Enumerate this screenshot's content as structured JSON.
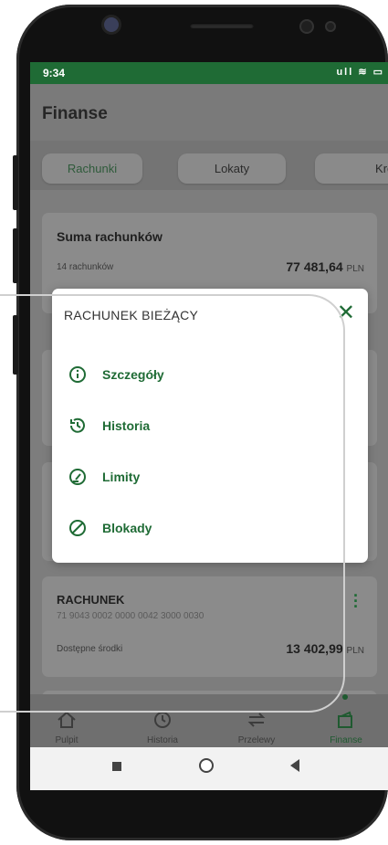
{
  "status_bar": {
    "time": "9:34",
    "icons": "ull ≋ ▭"
  },
  "app_bar": {
    "title": "Finanse"
  },
  "tabs": [
    {
      "label": "Rachunki",
      "active": true
    },
    {
      "label": "Lokaty",
      "active": false
    },
    {
      "label": "Kredy",
      "active": false
    }
  ],
  "summary_card": {
    "title": "Suma rachunków",
    "count": "14 rachunków",
    "amount": "77 481,64",
    "currency": "PLN"
  },
  "account_card": {
    "title": "RACHUNEK",
    "number": "71 9043 0002 0000 0042 3000 0030",
    "available_label": "Dostępne środki",
    "amount": "13 402,99",
    "currency": "PLN"
  },
  "modal": {
    "title": "RACHUNEK BIEŻĄCY",
    "items": [
      {
        "label": "Szczegóły",
        "icon": "info-icon"
      },
      {
        "label": "Historia",
        "icon": "history-icon"
      },
      {
        "label": "Limity",
        "icon": "gauge-icon"
      },
      {
        "label": "Blokady",
        "icon": "block-icon"
      }
    ]
  },
  "bottom_nav": [
    {
      "label": "Pulpit",
      "icon": "home-icon",
      "active": false
    },
    {
      "label": "Historia",
      "icon": "history-icon",
      "active": false
    },
    {
      "label": "Przelewy",
      "icon": "transfer-icon",
      "active": false
    },
    {
      "label": "Finanse",
      "icon": "wallet-icon",
      "active": true
    }
  ],
  "colors": {
    "accent": "#1f6b35",
    "overlay": "#7d7d7d"
  }
}
